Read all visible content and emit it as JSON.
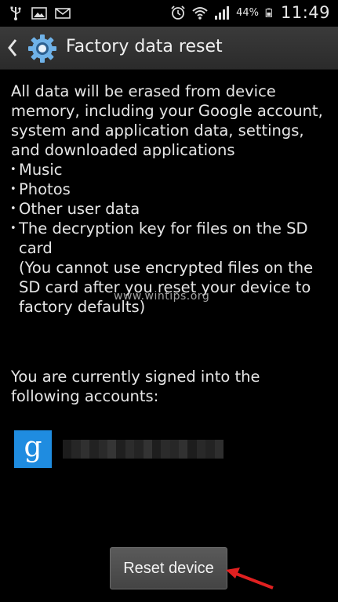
{
  "status_bar": {
    "left_icons": [
      "usb-icon",
      "gallery-icon",
      "email-icon"
    ],
    "right_icons": [
      "alarm-icon",
      "wifi-icon",
      "signal-icon",
      "battery-icon"
    ],
    "battery_percent": "44%",
    "time": "11:49"
  },
  "action_bar": {
    "title": "Factory data reset"
  },
  "content": {
    "intro": "All data will be erased from device memory, including your Google account, system and application data, settings, and downloaded applications",
    "bullets": [
      "Music",
      "Photos",
      "Other user data",
      "The decryption key for files on the SD card"
    ],
    "bullet_note": "(You cannot use encrypted files on the SD card after you reset your device to factory defaults)",
    "signed_in_text": "You are currently signed into the following accounts:"
  },
  "account": {
    "icon": "google-account-icon",
    "logo_letter": "g",
    "logo_color": "#1f8ce0"
  },
  "watermark": "www.wintips.org",
  "reset_button_label": "Reset device",
  "colors": {
    "background": "#000000",
    "action_bar": "#2f2f2f",
    "text": "#e6e6e6",
    "arrow": "#e02020"
  }
}
